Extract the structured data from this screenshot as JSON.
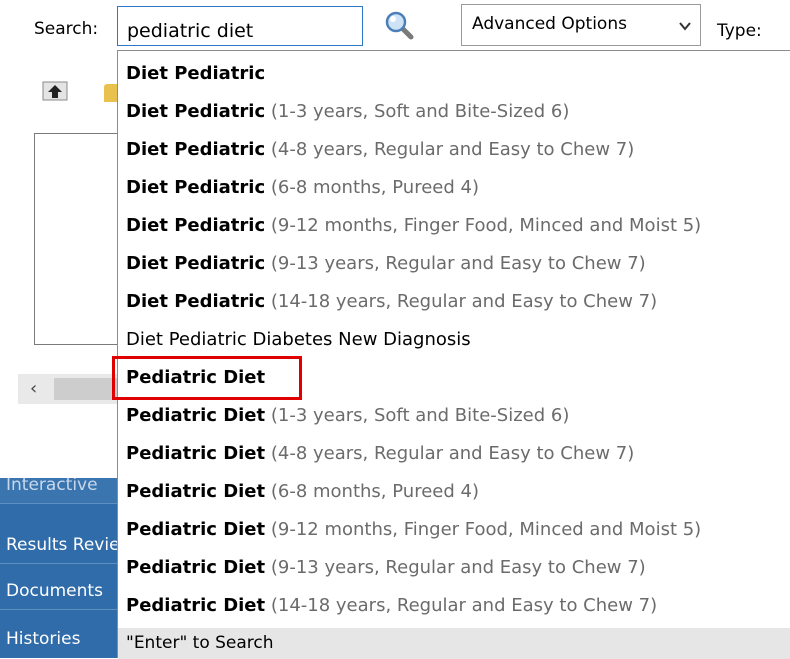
{
  "search": {
    "label": "Search:",
    "value": "pediatric diet",
    "advanced_label": "Advanced Options",
    "type_label": "Type:"
  },
  "nav": {
    "partial": "Interactive",
    "results": "Results Review",
    "documents": "Documents",
    "histories": "Histories"
  },
  "dropdown": {
    "options": [
      {
        "name": "Diet Pediatric",
        "detail": ""
      },
      {
        "name": "Diet Pediatric",
        "detail": "(1-3 years, Soft and Bite-Sized 6)"
      },
      {
        "name": "Diet Pediatric",
        "detail": "(4-8 years, Regular and Easy to Chew 7)"
      },
      {
        "name": "Diet Pediatric",
        "detail": "(6-8 months, Pureed 4)"
      },
      {
        "name": "Diet Pediatric",
        "detail": "(9-12 months, Finger Food, Minced and Moist 5)"
      },
      {
        "name": "Diet Pediatric",
        "detail": "(9-13 years, Regular and Easy to Chew 7)"
      },
      {
        "name": "Diet Pediatric",
        "detail": "(14-18 years, Regular and Easy to Chew 7)"
      },
      {
        "name": "Diet Pediatric Diabetes New Diagnosis",
        "detail": ""
      },
      {
        "name": "Pediatric Diet",
        "detail": ""
      },
      {
        "name": "Pediatric Diet",
        "detail": "(1-3 years, Soft and Bite-Sized 6)"
      },
      {
        "name": "Pediatric Diet",
        "detail": "(4-8 years, Regular and Easy to Chew 7)"
      },
      {
        "name": "Pediatric Diet",
        "detail": "(6-8 months, Pureed 4)"
      },
      {
        "name": "Pediatric Diet",
        "detail": "(9-12 months, Finger Food, Minced and Moist 5)"
      },
      {
        "name": "Pediatric Diet",
        "detail": "(9-13 years, Regular and Easy to Chew 7)"
      },
      {
        "name": "Pediatric Diet",
        "detail": "(14-18 years, Regular and Easy to Chew 7)"
      }
    ],
    "enter_hint": "\"Enter\" to Search"
  },
  "colors": {
    "nav_bg": "#2f6ca9",
    "highlight": "#e00000",
    "input_border": "#2f76c8"
  }
}
